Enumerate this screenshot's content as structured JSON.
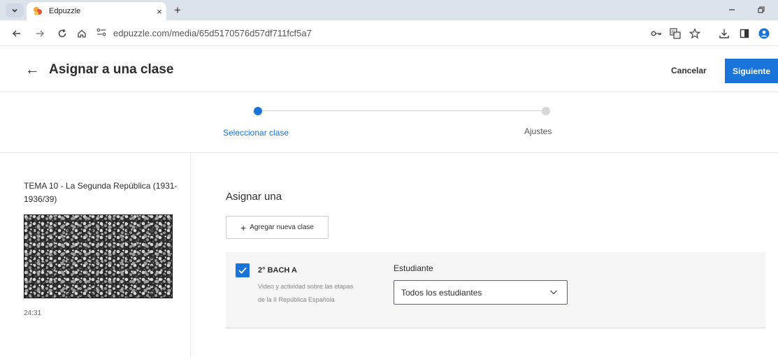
{
  "browser": {
    "tab_title": "Edpuzzle",
    "tab_close": "×",
    "new_tab": "+",
    "url": "edpuzzle.com/media/65d5170576d57df711fcf5a7"
  },
  "header": {
    "back_symbol": "←",
    "title": "Asignar a una clase",
    "cancel_label": "Cancelar",
    "next_label": "Siguiente"
  },
  "stepper": {
    "steps": [
      {
        "label": "Seleccionar clase"
      },
      {
        "label": "Ajustes"
      }
    ]
  },
  "video": {
    "title": "TEMA 10 - La Segunda República (1931-1936/39)",
    "duration": "24:31"
  },
  "assign": {
    "heading": "Asignar una",
    "add_class_label": "Agregar nueva clase",
    "add_class_symbol": "+"
  },
  "classes": [
    {
      "name": "2° BACH A",
      "description": "Video y actividad sobre las etapas de la II República Española",
      "checked": true,
      "student_label": "Estudiante",
      "student_value": "Todos los estudiantes"
    }
  ],
  "colors": {
    "accent": "#1a73d9",
    "tabbar": "#dde3ea"
  }
}
